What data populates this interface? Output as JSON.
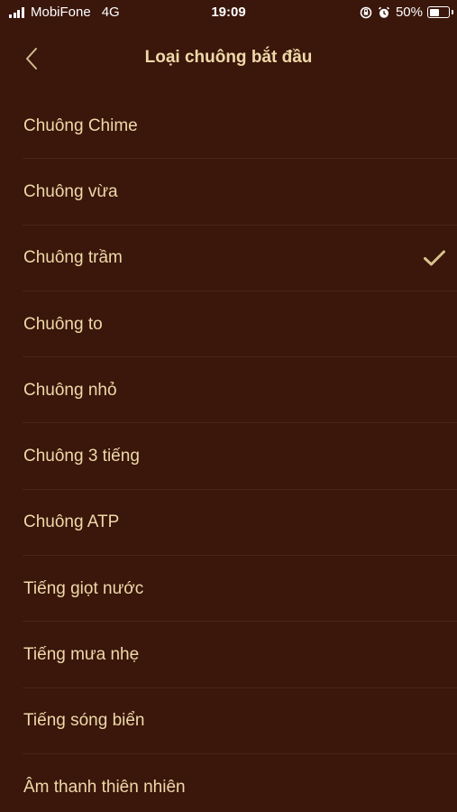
{
  "status_bar": {
    "carrier": "MobiFone",
    "network": "4G",
    "time": "19:09",
    "battery": "50%",
    "battery_level": 0.5,
    "icons": [
      "rotation-lock-icon",
      "alarm-icon"
    ]
  },
  "nav": {
    "title": "Loại chuông bắt đầu",
    "back_icon": "chevron-left-icon"
  },
  "list": {
    "items": [
      {
        "label": "Chuông Chime",
        "selected": false
      },
      {
        "label": "Chuông vừa",
        "selected": false
      },
      {
        "label": "Chuông trầm",
        "selected": true
      },
      {
        "label": "Chuông to",
        "selected": false
      },
      {
        "label": "Chuông nhỏ",
        "selected": false
      },
      {
        "label": "Chuông 3 tiếng",
        "selected": false
      },
      {
        "label": "Chuông ATP",
        "selected": false
      },
      {
        "label": "Tiếng giọt nước",
        "selected": false
      },
      {
        "label": "Tiếng mưa nhẹ",
        "selected": false
      },
      {
        "label": "Tiếng sóng biển",
        "selected": false
      },
      {
        "label": "Âm thanh thiên nhiên",
        "selected": false
      }
    ],
    "check_icon": "checkmark-icon"
  },
  "colors": {
    "background": "#3a160b",
    "text": "#efd9a8",
    "separator": "#4b2415",
    "checkmark": "#d8c28e"
  }
}
